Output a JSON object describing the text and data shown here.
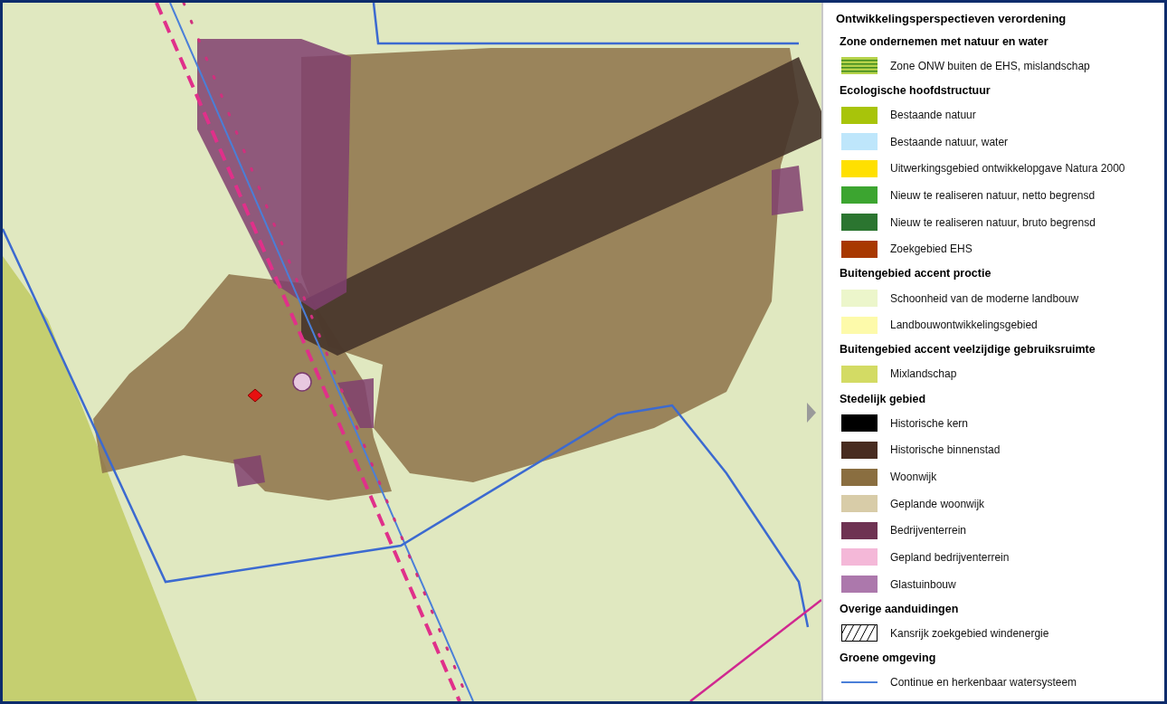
{
  "legend": {
    "title": "Ontwikkelingsperspectieven verordening",
    "sections": [
      {
        "title": "Zone ondernemen met natuur en water",
        "items": [
          {
            "label": "Zone ONW buiten de EHS, mislandschap",
            "kind": "stripes",
            "color": "#b5d24a"
          }
        ]
      },
      {
        "title": "Ecologische hoofdstructuur",
        "items": [
          {
            "label": "Bestaande natuur",
            "kind": "fill",
            "color": "#a8c40a"
          },
          {
            "label": "Bestaande natuur, water",
            "kind": "fill",
            "color": "#bee6fb"
          },
          {
            "label": "Uitwerkingsgebied ontwikkelopgave Natura 2000",
            "kind": "fill",
            "color": "#ffe000"
          },
          {
            "label": "Nieuw te realiseren natuur, netto begrensd",
            "kind": "fill",
            "color": "#3ca530"
          },
          {
            "label": "Nieuw te realiseren natuur, bruto begrensd",
            "kind": "fill",
            "color": "#2b7530"
          },
          {
            "label": "Zoekgebied EHS",
            "kind": "fill",
            "color": "#a83800"
          }
        ]
      },
      {
        "title": "Buitengebied accent proctie",
        "items": [
          {
            "label": "Schoonheid van de moderne landbouw",
            "kind": "fill",
            "color": "#ecf6cb"
          },
          {
            "label": "Landbouwontwikkelingsgebied",
            "kind": "fill",
            "color": "#fdfaaa"
          }
        ]
      },
      {
        "title": "Buitengebied accent veelzijdige gebruiksruimte",
        "items": [
          {
            "label": "Mixlandschap",
            "kind": "fill",
            "color": "#d3db64"
          }
        ]
      },
      {
        "title": "Stedelijk gebied",
        "items": [
          {
            "label": "Historische kern",
            "kind": "fill",
            "color": "#000000"
          },
          {
            "label": "Historische binnenstad",
            "kind": "fill",
            "color": "#482c20"
          },
          {
            "label": "Woonwijk",
            "kind": "fill",
            "color": "#8a6e40"
          },
          {
            "label": "Geplande woonwijk",
            "kind": "fill",
            "color": "#d8cca8"
          },
          {
            "label": "Bedrijventerrein",
            "kind": "fill",
            "color": "#6e3252"
          },
          {
            "label": "Gepland bedrijventerrein",
            "kind": "fill",
            "color": "#f4b8d8"
          },
          {
            "label": "Glastuinbouw",
            "kind": "fill",
            "color": "#ac78ac"
          }
        ]
      },
      {
        "title": "Overige aanduidingen",
        "items": [
          {
            "label": "Kansrijk zoekgebied windenergie",
            "kind": "hatch",
            "color": "#000000"
          }
        ]
      },
      {
        "title": "Groene omgeving",
        "items": [
          {
            "label": "Continue en herkenbaar watersysteem",
            "kind": "line",
            "color": "#4a7fd8"
          }
        ]
      }
    ]
  }
}
